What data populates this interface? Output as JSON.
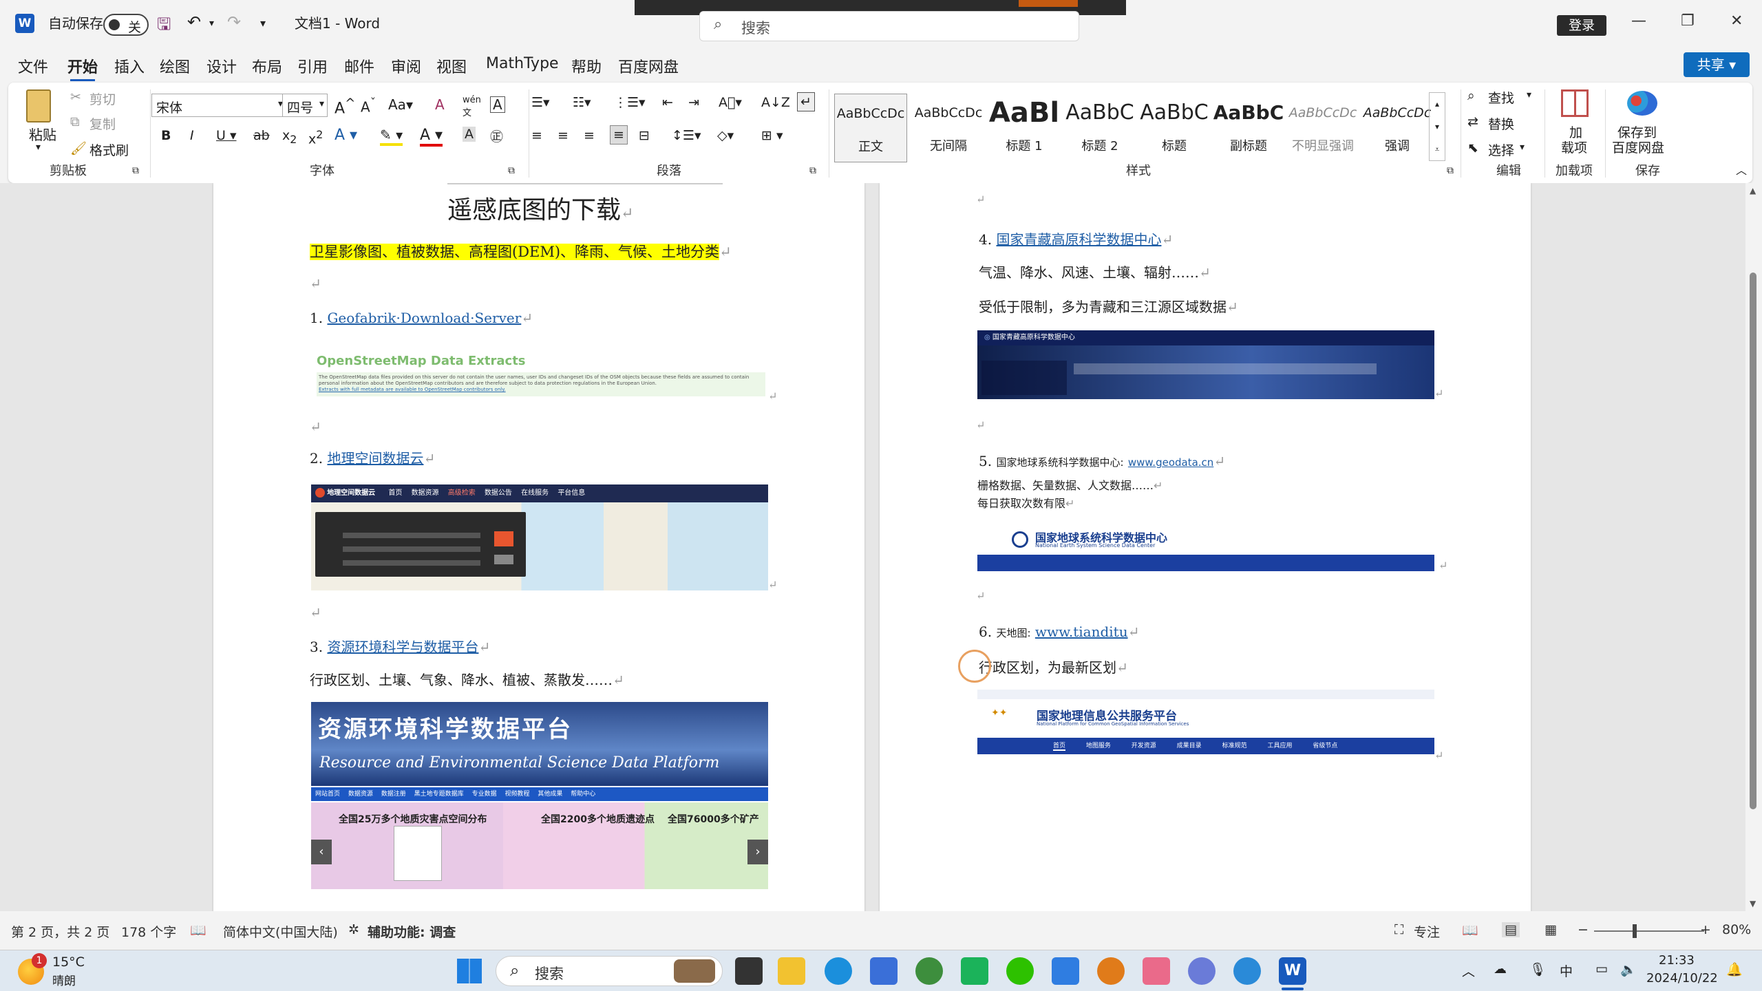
{
  "app": {
    "autosave_label": "自动保存",
    "autosave_state": "关",
    "doc_title": "文档1 - Word",
    "search_placeholder": "搜索",
    "login": "登录",
    "share": "共享"
  },
  "menu": [
    "文件",
    "开始",
    "插入",
    "绘图",
    "设计",
    "布局",
    "引用",
    "邮件",
    "审阅",
    "视图",
    "MathType",
    "帮助",
    "百度网盘"
  ],
  "ribbon": {
    "clipboard": {
      "paste": "粘贴",
      "cut": "剪切",
      "copy": "复制",
      "format_painter": "格式刷",
      "group": "剪贴板"
    },
    "font": {
      "name": "宋体",
      "size": "四号",
      "group": "字体"
    },
    "paragraph": {
      "group": "段落"
    },
    "styles": {
      "items": [
        {
          "preview": "AaBbCcDc",
          "name": "正文"
        },
        {
          "preview": "AaBbCcDc",
          "name": "无间隔"
        },
        {
          "preview": "AaBl",
          "name": "标题 1"
        },
        {
          "preview": "AaBbC",
          "name": "标题 2"
        },
        {
          "preview": "AaBbC",
          "name": "标题"
        },
        {
          "preview": "AaBbC",
          "name": "副标题"
        },
        {
          "preview": "AaBbCcDc",
          "name": "不明显强调"
        },
        {
          "preview": "AaBbCcDc",
          "name": "强调"
        }
      ],
      "group": "样式"
    },
    "edit": {
      "find": "查找",
      "replace": "替换",
      "select": "选择",
      "group": "编辑"
    },
    "addins": {
      "label1": "加",
      "label2": "载项",
      "group": "加载项"
    },
    "save": {
      "label1": "保存到",
      "label2": "百度网盘",
      "group": "保存"
    }
  },
  "page1": {
    "title": "遥感底图的下载",
    "highlight": "卫星影像图、植被数据、高程图(DEM)、降雨、气候、土地分类",
    "item1_num": "1.",
    "item1_link": "Geofabrik·Download·Server",
    "osm_title": "OpenStreetMap Data Extracts",
    "osm_text": "The OpenStreetMap data files provided on this server do not contain the user names, user IDs and changeset IDs of the OSM objects because these fields are assumed to contain personal information about the OpenStreetMap contributors and are therefore subject to data protection regulations in the European Union.",
    "osm_link": "Extracts with full metadata are available to OpenStreetMap contributors only.",
    "item2_num": "2.",
    "item2_link": "地理空间数据云",
    "gs_logo": "地理空间数据云",
    "gs_nav": [
      "首页",
      "数据资源",
      "高级检索",
      "数据公告",
      "在线服务",
      "平台信息"
    ],
    "item3_num": "3.",
    "item3_link": "资源环境科学与数据平台",
    "item3_desc": "行政区划、土壤、气象、降水、植被、蒸散发……",
    "resdc_cn": "资源环境科学数据平台",
    "resdc_en": "Resource and Environmental Science Data Platform",
    "resdc_nav": [
      "网站首页",
      "数据资源",
      "数据注册",
      "黑土地专题数据库",
      "专业数据",
      "视频教程",
      "其他成果",
      "帮助中心"
    ],
    "resdc_map1": "全国25万多个地质灾害点空间分布",
    "resdc_map2": "全国2200多个地质遗迹点",
    "resdc_map3": "全国76000多个矿产"
  },
  "page2": {
    "item4_num": "4.",
    "item4_link": "国家青藏高原科学数据中心",
    "item4_desc": "气温、降水、风速、土壤、辐射……",
    "item4_note": "受低于限制，多为青藏和三江源区域数据",
    "tp_title": "国家青藏高原科学数据中心",
    "item5_num": "5.",
    "item5_label": "国家地球系统科学数据中心:",
    "item5_link": "www.geodata.cn",
    "item5_desc": "栅格数据、矢量数据、人文数据……",
    "item5_note": "每日获取次数有限",
    "geo_cn": "国家地球系统科学数据中心",
    "geo_en": "National Earth System Science Data Center",
    "item6_num": "6.",
    "item6_label": "天地图:",
    "item6_link": "www.tianditu",
    "item6_desc": "行政区划，为最新区划",
    "td_cn": "国家地理信息公共服务平台",
    "td_en": "National Platform for Common GeoSpatial Information Services",
    "td_nav": [
      "首页",
      "地图服务",
      "开发资源",
      "成果目录",
      "标准规范",
      "工具应用",
      "省级节点"
    ]
  },
  "status": {
    "page": "第 2 页，共 2 页",
    "words": "178 个字",
    "lang": "简体中文(中国大陆)",
    "access": "辅助功能: 调查",
    "focus": "专注",
    "zoom": "80%"
  },
  "taskbar": {
    "temp": "15°C",
    "weather": "晴朗",
    "badge": "1",
    "search": "搜索",
    "ime": "中",
    "time": "21:33",
    "date": "2024/10/22"
  }
}
